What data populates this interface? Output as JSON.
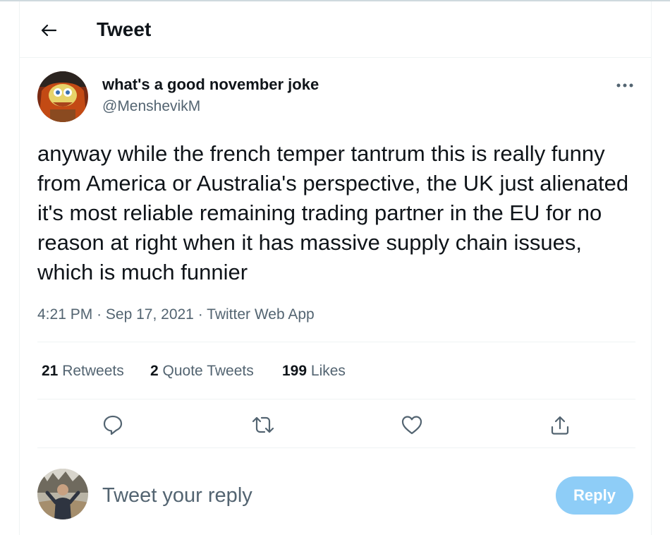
{
  "header": {
    "title": "Tweet",
    "back_icon": "arrow-left-icon"
  },
  "tweet": {
    "display_name": "what's a good november joke",
    "handle": "@MenshevikM",
    "more_icon": "more-horizontal-icon",
    "text": "anyway while the french temper tantrum this is really funny from America or Australia's perspective, the UK just alienated it's most reliable remaining trading partner in the EU for no reason at right when it has massive supply chain issues, which is much funnier",
    "time": "4:21 PM",
    "separator": "·",
    "date": "Sep 17, 2021",
    "source": "Twitter Web App"
  },
  "stats": {
    "retweets_count": "21",
    "retweets_label": "Retweets",
    "quotes_count": "2",
    "quotes_label": "Quote Tweets",
    "likes_count": "199",
    "likes_label": "Likes"
  },
  "actions": [
    "reply-icon",
    "retweet-icon",
    "like-icon",
    "share-icon"
  ],
  "reply_box": {
    "placeholder": "Tweet your reply",
    "button_label": "Reply"
  },
  "colors": {
    "text": "#0f1419",
    "secondary": "#536471",
    "border": "#eff3f4",
    "reply_button_disabled": "#8ecdf7"
  }
}
